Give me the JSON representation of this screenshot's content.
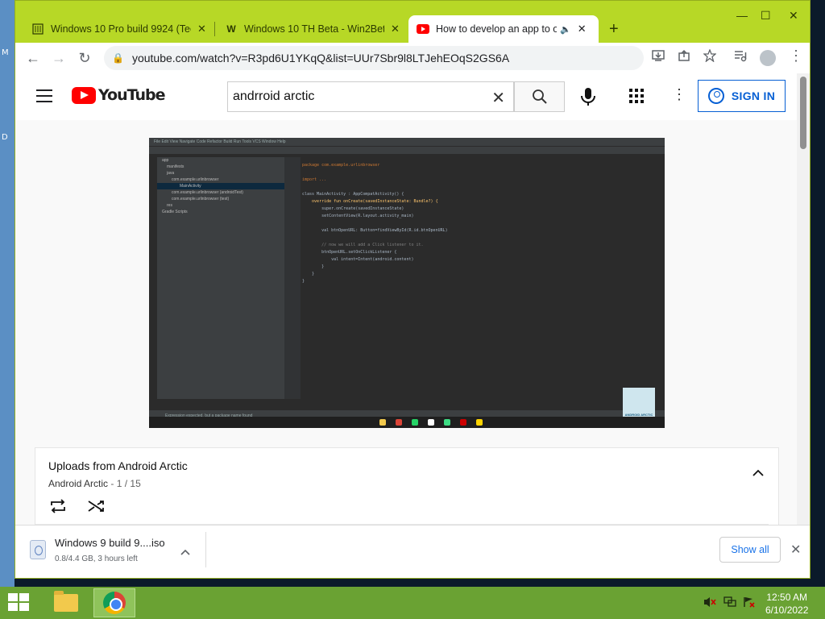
{
  "desktop": {
    "edge_letters": [
      "M",
      "D"
    ]
  },
  "tabs": [
    {
      "title": "Windows 10 Pro build 9924 (Tech",
      "favicon": "building-icon",
      "close": "✕"
    },
    {
      "title": "Windows 10 TH Beta - Win2Beta",
      "favicon": "w-icon",
      "close": "✕"
    },
    {
      "title": "How to develop an app to op",
      "favicon": "youtube-icon",
      "close": "✕",
      "audio": "🔈"
    }
  ],
  "new_tab": "+",
  "window_controls": {
    "minimize": "—",
    "maximize": "☐",
    "close": "✕"
  },
  "toolbar": {
    "back": "←",
    "forward": "→",
    "reload": "↻",
    "url": "youtube.com/watch?v=R3pd6U1YKqQ&list=UUr7Sbr9l8LTJehEOqS2GS6A",
    "lock": "🔒",
    "more": "⋮"
  },
  "youtube": {
    "logo_text": "YouTube",
    "search_value": "andrroid arctic",
    "search_clear": "✕",
    "signin_label": "SIGN IN",
    "more": "⋮"
  },
  "video": {
    "ide_menu": "File  Edit  View  Navigate  Code  Refactor  Build  Run  Tools  VCS  Window  Help",
    "tree": [
      "app",
      "manifests",
      "java",
      "com.example.urlinbrowser",
      "MainActivity",
      "com.example.urlinbrowser (androidTest)",
      "com.example.urlinbrowser (test)",
      "res",
      "Gradle Scripts"
    ],
    "code": [
      "package com.example.urlinbrowser",
      "",
      "import ...",
      "",
      "class MainActivity : AppCompatActivity() {",
      "    override fun onCreate(savedInstanceState: Bundle?) {",
      "        super.onCreate(savedInstanceState)",
      "        setContentView(R.layout.activity_main)",
      "",
      "        val btnOpenURL: Button=findViewById(R.id.btnOpenURL)",
      "",
      "        // now we will add a Click listener to it.",
      "        btnOpenURL.setOnClickListener {",
      "            val intent=Intent(android.content)",
      "        }",
      "    }",
      "}"
    ],
    "status_text": "Expression expected, but a package name found",
    "watermark_text": "ANDROID ARCTIC"
  },
  "playlist": {
    "title": "Uploads from Android Arctic",
    "channel": "Android Arctic",
    "separator": " - ",
    "position": "1 / 15"
  },
  "download": {
    "filename": "Windows 9 build 9....iso",
    "status": "0.8/4.4 GB, 3 hours left",
    "show_all": "Show all",
    "close": "✕"
  },
  "taskbar": {
    "time": "12:50 AM",
    "date": "6/10/2022"
  },
  "colors": {
    "chrome_frame": "#b7d826",
    "taskbar": "#6aa233",
    "youtube_red": "#ff0000",
    "signin_blue": "#065fd4"
  }
}
